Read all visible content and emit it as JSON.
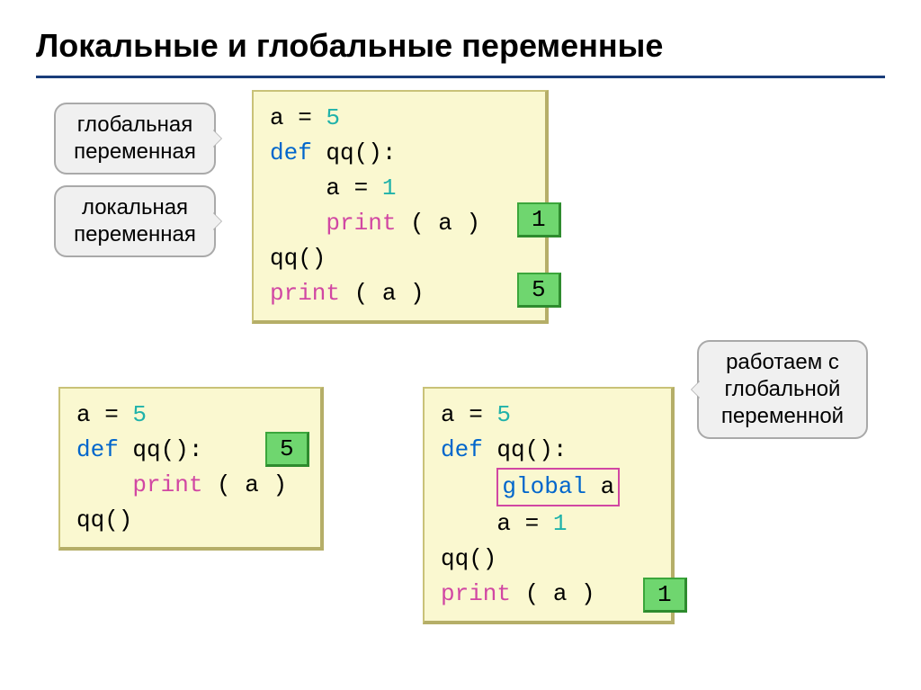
{
  "title": "Локальные и глобальные переменные",
  "callouts": {
    "global_var": "глобальная\nпеременная",
    "local_var": "локальная\nпеременная",
    "work_global": "работаем с\nглобальной\nпеременной"
  },
  "code1": {
    "l1_a": "a",
    "l1_eq": " = ",
    "l1_v": "5",
    "l2": "def",
    "l2_b": " qq():",
    "l3": "    a",
    "l3_eq": " = ",
    "l3_v": "1",
    "l4_a": "    ",
    "l4_b": "print",
    "l4_c": " ( a )",
    "l5": "qq()",
    "l6_a": "print",
    "l6_b": " ( a )"
  },
  "code2": {
    "l1_a": "a",
    "l1_eq": " = ",
    "l1_v": "5",
    "l2": "def",
    "l2_b": " qq():",
    "l3_a": "    ",
    "l3_b": "print",
    "l3_c": " ( a )",
    "l4": "qq()"
  },
  "code3": {
    "l1_a": "a",
    "l1_eq": " = ",
    "l1_v": "5",
    "l2": "def",
    "l2_b": " qq():",
    "l3_a": "    ",
    "l3_b": "global",
    "l3_c": " a",
    "l4": "    a",
    "l4_eq": " = ",
    "l4_v": "1",
    "l5": "qq()",
    "l6_a": "print",
    "l6_b": " ( a )"
  },
  "results": {
    "r1": "1",
    "r2": "5",
    "r3": "5",
    "r4": "1"
  }
}
